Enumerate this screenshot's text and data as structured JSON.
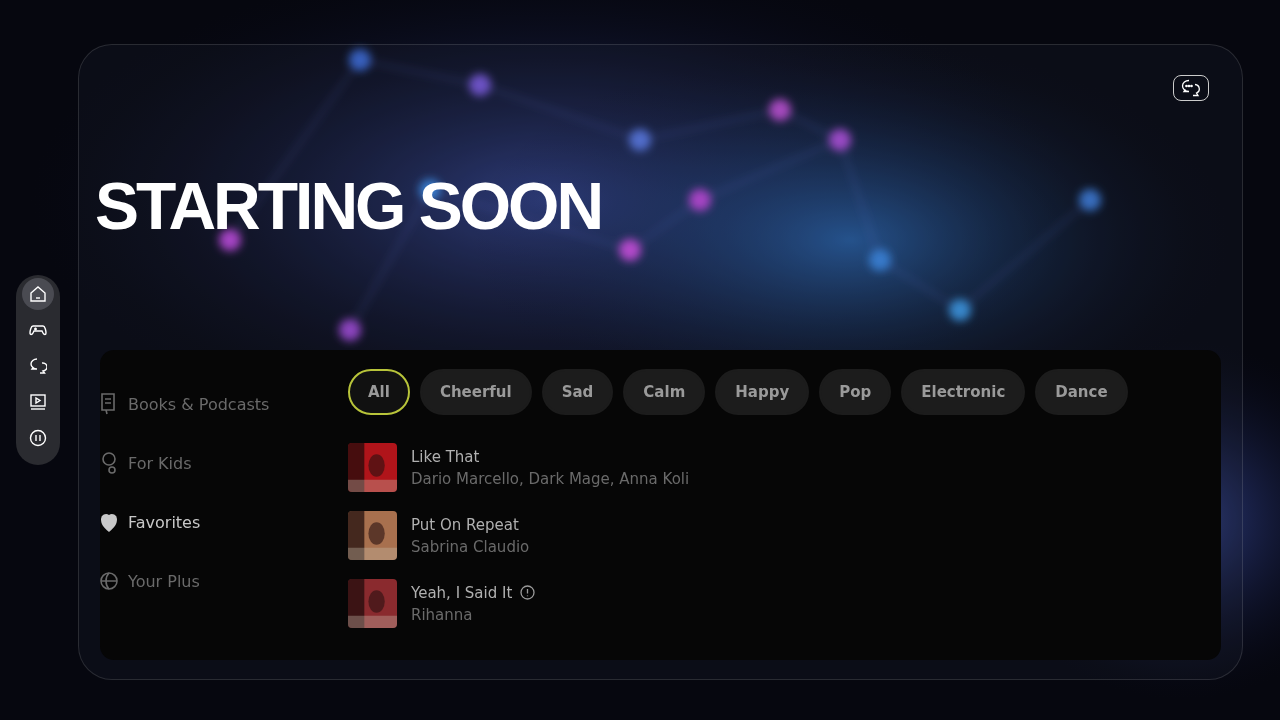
{
  "banner": {
    "title": "STARTING SOON"
  },
  "dock": [
    {
      "selected": true
    },
    {
      "selected": false
    },
    {
      "selected": false
    },
    {
      "selected": false
    },
    {
      "selected": false
    }
  ],
  "sidebar": {
    "items": [
      {
        "label": "Books & Podcasts",
        "selected": false
      },
      {
        "label": "For Kids",
        "selected": false
      },
      {
        "label": "Favorites",
        "selected": true
      },
      {
        "label": "Your Plus",
        "selected": false
      }
    ]
  },
  "filters": [
    {
      "label": "All",
      "selected": true
    },
    {
      "label": "Cheerful",
      "selected": false
    },
    {
      "label": "Sad",
      "selected": false
    },
    {
      "label": "Calm",
      "selected": false
    },
    {
      "label": "Happy",
      "selected": false
    },
    {
      "label": "Pop",
      "selected": false
    },
    {
      "label": "Electronic",
      "selected": false
    },
    {
      "label": "Dance",
      "selected": false
    }
  ],
  "tracks": [
    {
      "title": "Like That",
      "artist": "Dario Marcello, Dark Mage, Anna Koli",
      "explicit": false,
      "color": "#b0141a"
    },
    {
      "title": "Put On Repeat",
      "artist": "Sabrina Claudio",
      "explicit": false,
      "color": "#a8704e"
    },
    {
      "title": "Yeah, I Said It",
      "artist": "Rihanna",
      "explicit": true,
      "color": "#8a2a2e"
    }
  ]
}
